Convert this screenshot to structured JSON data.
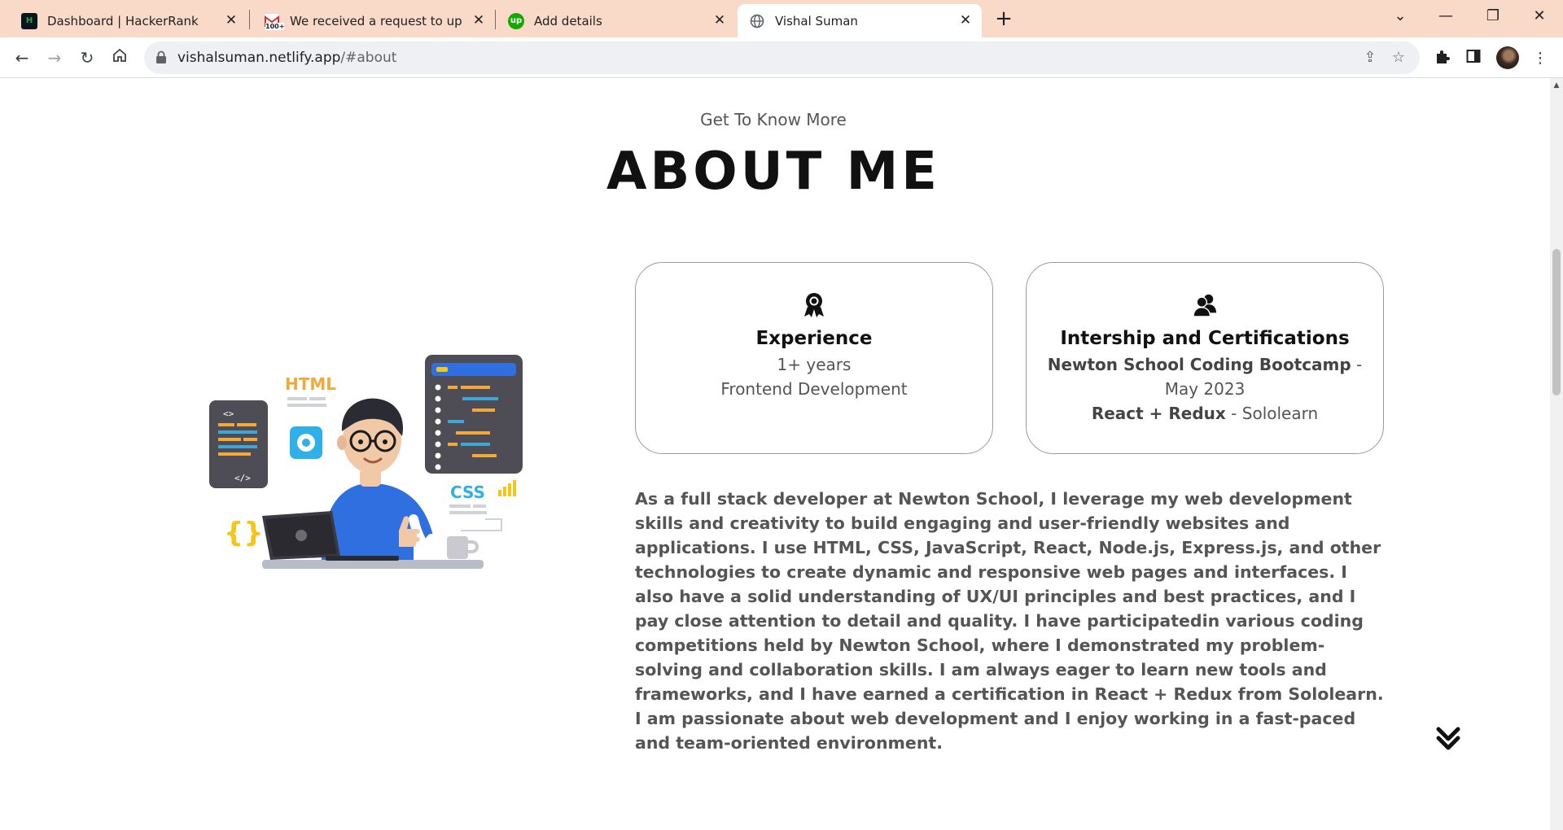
{
  "browser": {
    "tabs": [
      {
        "title": "Dashboard | HackerRank",
        "icon": "hackerrank-icon"
      },
      {
        "title": "We received a request to update",
        "icon": "gmail-icon",
        "badge": "100+"
      },
      {
        "title": "Add details",
        "icon": "upwork-icon"
      },
      {
        "title": "Vishal Suman",
        "icon": "globe-icon",
        "active": true
      }
    ],
    "url_host": "vishalsuman.netlify.app",
    "url_path": "/#about"
  },
  "about": {
    "subtitle": "Get To Know More",
    "heading": "ABOUT ME",
    "illustration_labels": {
      "html": "HTML",
      "css": "CSS"
    },
    "cards": [
      {
        "icon": "award-icon",
        "title": "Experience",
        "line1": "1+ years",
        "line2": "Frontend Development"
      },
      {
        "icon": "users-icon",
        "title": "Intership and Certifications",
        "line1_bold": "Newton School Coding Bootcamp",
        "line1_rest": " -",
        "line2": "May 2023",
        "line3_bold": "React + Redux",
        "line3_rest": " - Sololearn"
      }
    ],
    "bio": "As a full stack developer at Newton School, I leverage my web development skills and creativity to build engaging and user-friendly websites and applications. I use HTML, CSS, JavaScript, React, Node.js, Express.js, and other technologies to create dynamic and responsive web pages and interfaces. I also have a solid understanding of UX/UI principles and best practices, and I pay close attention to detail and quality. I have participatedin various coding competitions held by Newton School, where I demonstrated my problem-solving and collaboration skills. I am always eager to learn new tools and frameworks, and I have earned a certification in React + Redux from Sololearn. I am passionate about web development and I enjoy working in a fast-paced and team-oriented environment."
  }
}
